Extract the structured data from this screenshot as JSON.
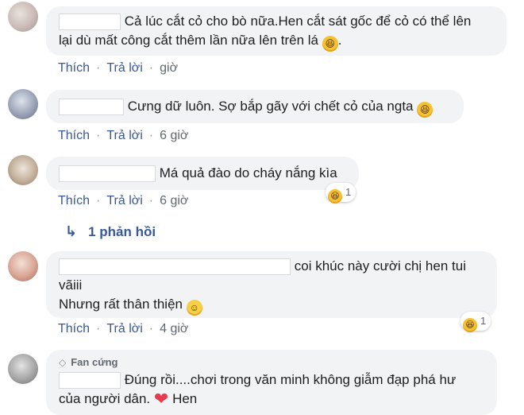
{
  "comments": [
    {
      "line1": "Cả lúc cắt cỏ cho bò nữa.Hen cắt sát gốc để cỏ có thể lên",
      "line2": "lại dù mất công cắt thêm lần nữa lên trên lá",
      "line2_tail": ".",
      "emoji": "laughing-icon",
      "like": "Thích",
      "reply": "Trả lời",
      "time": "giờ"
    },
    {
      "text": "Cưng dữ luôn. Sợ bắp gãy với chết cỏ của ngta",
      "emoji": "laughing-icon",
      "like": "Thích",
      "reply": "Trả lời",
      "time": "6 giờ"
    },
    {
      "text": "Má quả đào do cháy nắng kìa",
      "like": "Thích",
      "reply": "Trả lời",
      "time": "6 giờ",
      "reaction_count": "1",
      "replies_label": "1 phản hồi"
    },
    {
      "line1": "coi khúc này cười chị hen tui",
      "line2": "vãiii",
      "line3": "Nhưng rất thân thiện",
      "emoji": "smile-icon",
      "like": "Thích",
      "reply": "Trả lời",
      "time": "4 giờ",
      "reaction_count": "1"
    },
    {
      "badge": "Fan cứng",
      "line1": "Đúng rồi....chơi trong văn minh không giẫm đạp phá hư",
      "line2": "của người dân.",
      "line2_tail": "Hen",
      "emoji": "heart-icon"
    }
  ],
  "colors": {
    "bubble": "#f2f3f5",
    "link": "#385898",
    "meta": "#606770",
    "heart": "#e53b4f"
  }
}
